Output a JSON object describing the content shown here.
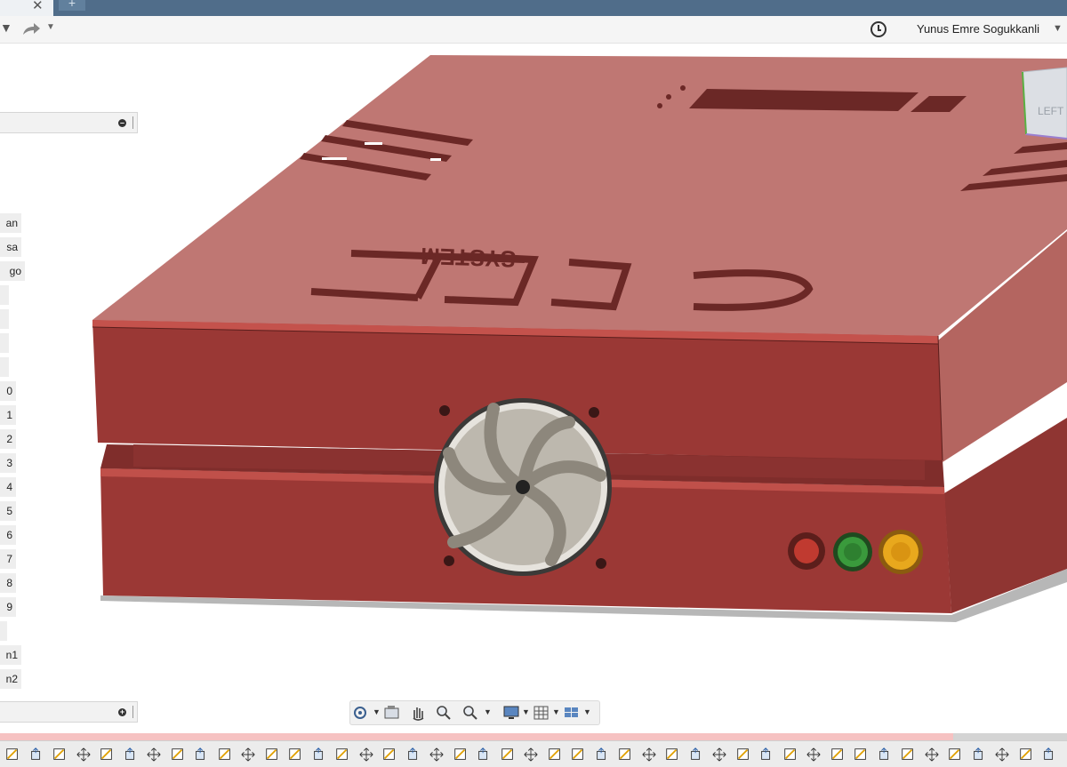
{
  "tabs": {
    "close_glyph": "✕",
    "new_tab_glyph": "+"
  },
  "toolbar": {
    "undo_icon": "undo-icon",
    "redo_icon": "redo-icon",
    "redo_dropdown_glyph": "▼"
  },
  "header": {
    "job_status_icon": "clock-icon",
    "user_name": "Yunus Emre Sogukkanli",
    "user_dropdown_glyph": "▼"
  },
  "viewcube": {
    "face_label": "LEFT"
  },
  "model": {
    "engraved_text": "CPIT",
    "engraved_subtext": "SYSTEM",
    "button_colors": [
      "#c03a30",
      "#3a9a3c",
      "#e8a81d"
    ],
    "body_color": "#9a3835",
    "lid_top_color": "#c07773"
  },
  "browser": {
    "items": [
      {
        "label": "an"
      },
      {
        "label": "sa"
      },
      {
        "label": "go"
      },
      {
        "label": ""
      },
      {
        "label": ""
      },
      {
        "label": ""
      },
      {
        "label": ""
      },
      {
        "label": "0"
      },
      {
        "label": "1"
      },
      {
        "label": "2"
      },
      {
        "label": "3"
      },
      {
        "label": "4"
      },
      {
        "label": "5"
      },
      {
        "label": "6"
      },
      {
        "label": "7"
      },
      {
        "label": "8"
      },
      {
        "label": "9"
      },
      {
        "label": ""
      },
      {
        "label": "n1"
      },
      {
        "label": "n2"
      }
    ]
  },
  "navigation": {
    "tools": [
      "orbit-icon",
      "look-at-icon",
      "pan-icon",
      "zoom-window-icon",
      "zoom-icon",
      "display-settings-icon",
      "grid-icon",
      "viewports-icon"
    ]
  }
}
